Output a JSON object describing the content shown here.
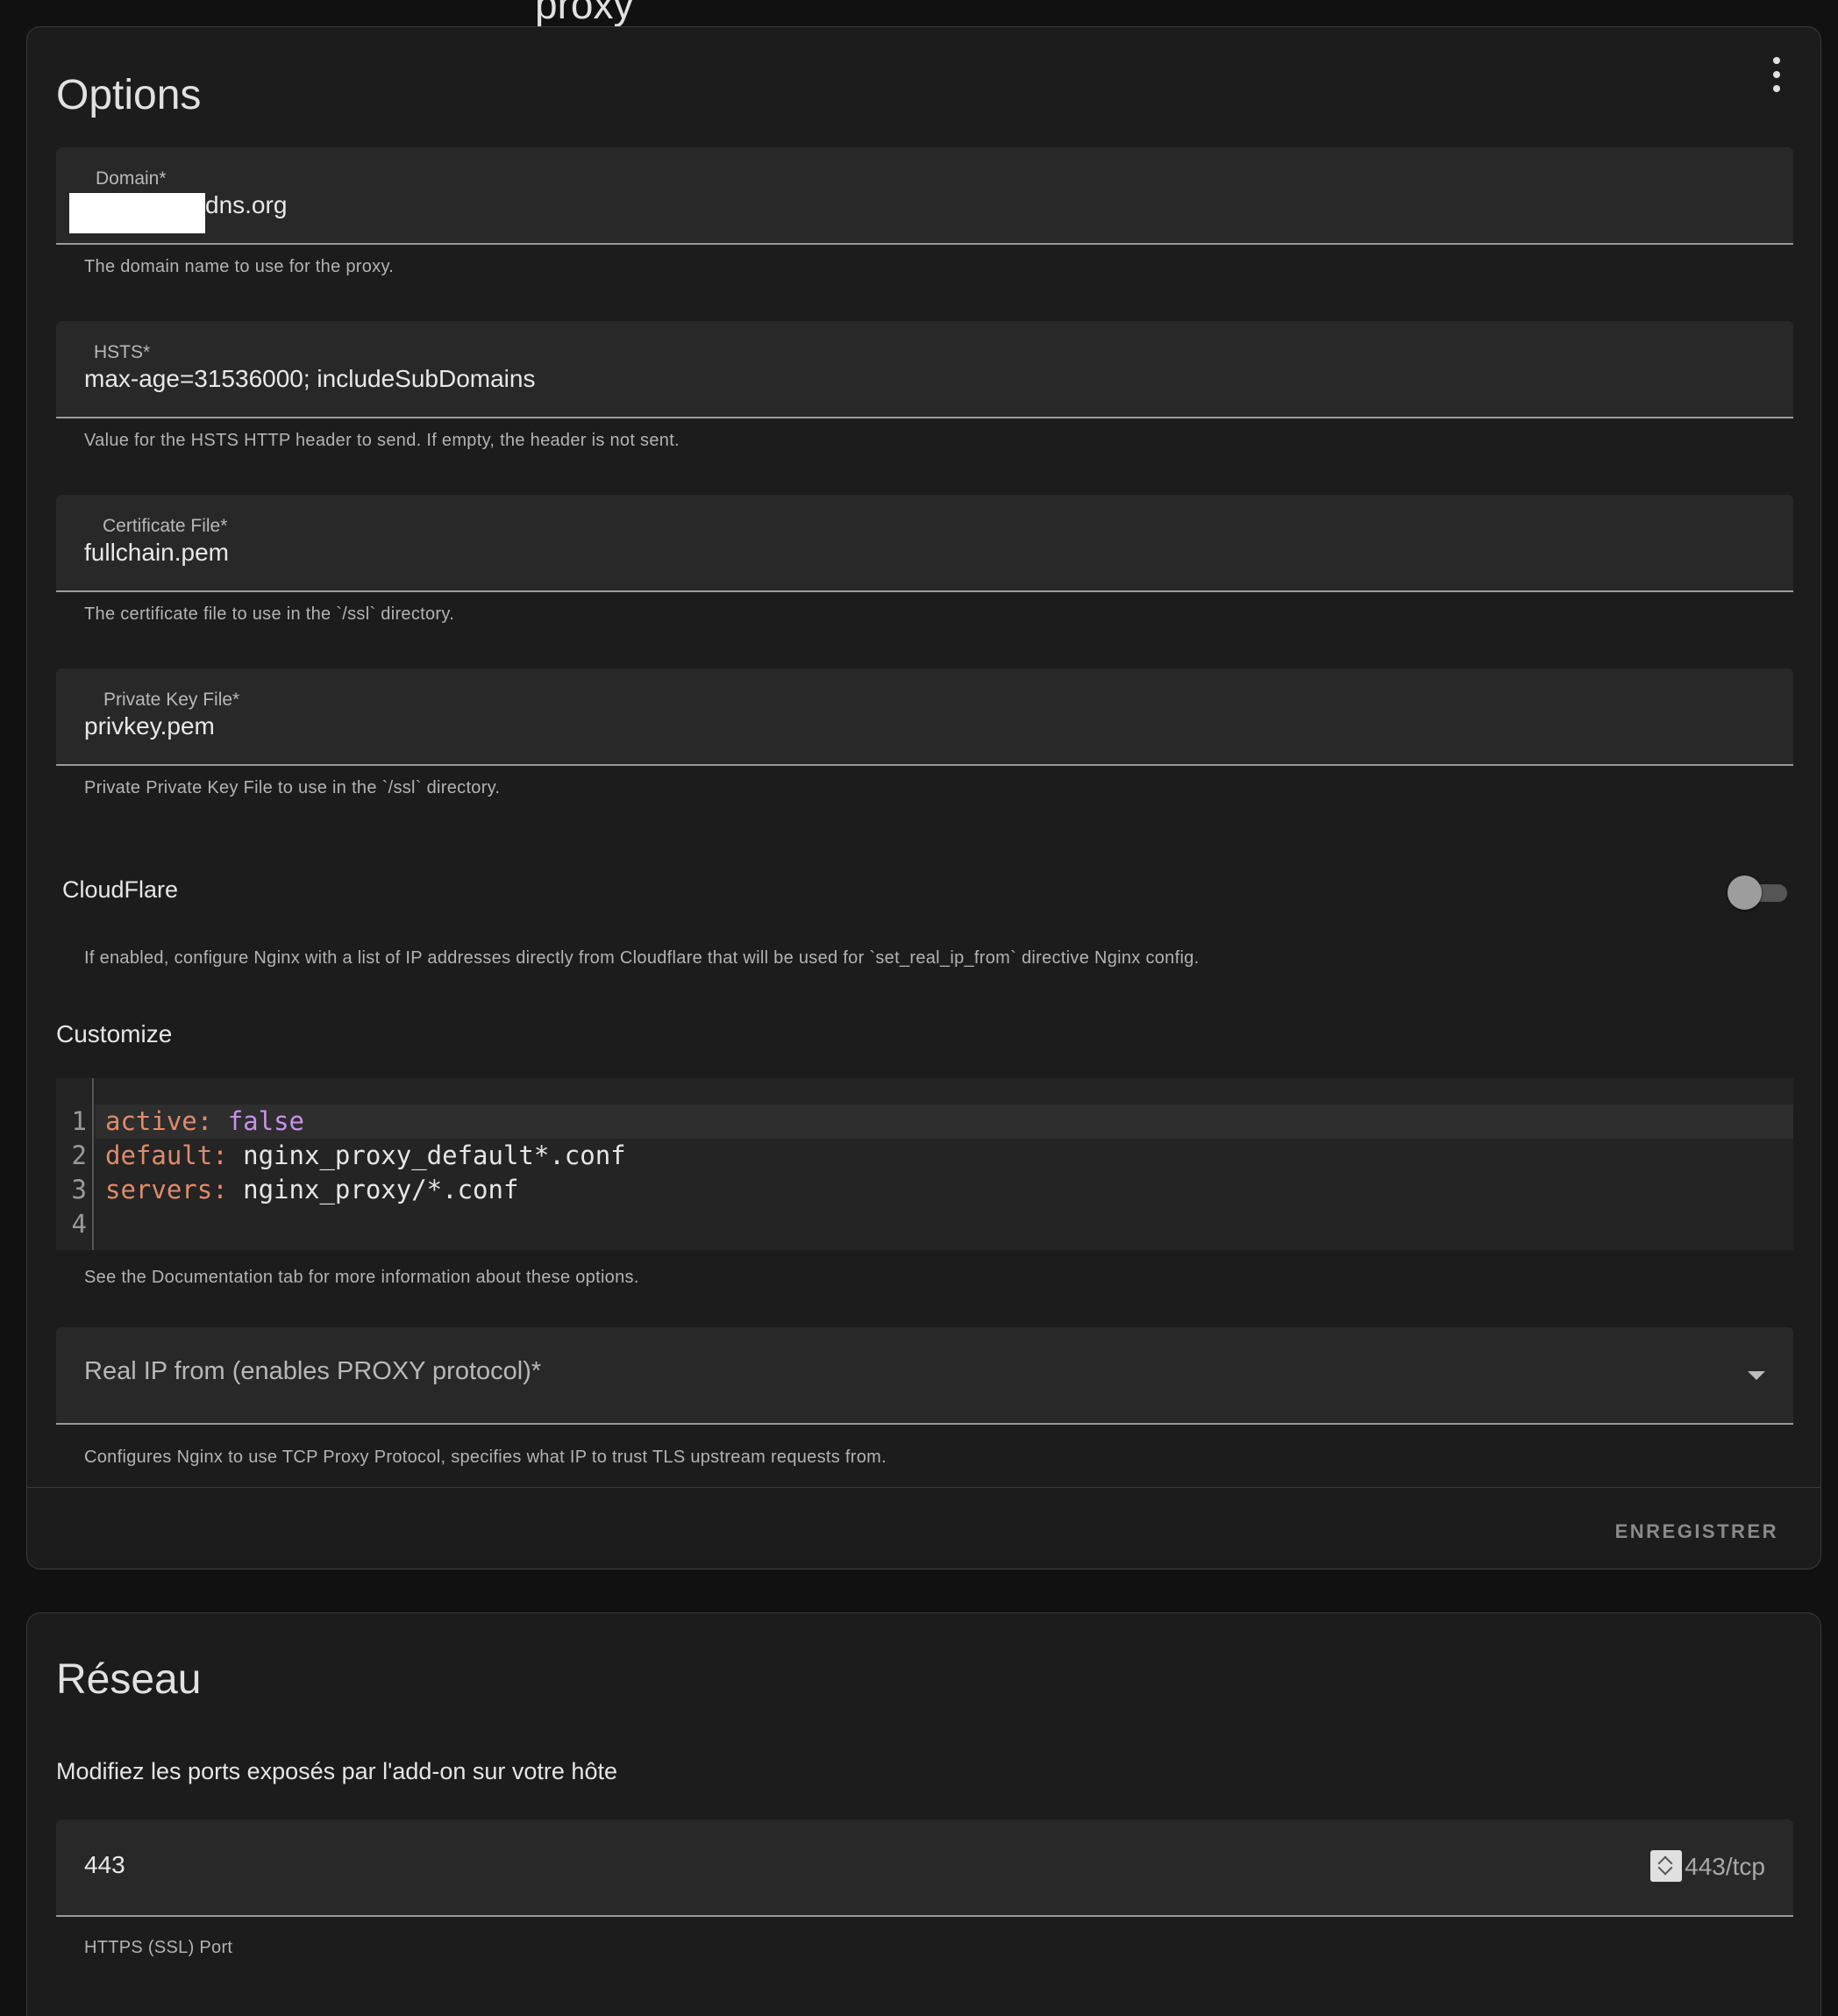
{
  "header": {
    "clipped_title": "proxy"
  },
  "options": {
    "title": "Options",
    "fields": [
      {
        "label": "Domain*",
        "value": "dns.org",
        "helper": "The domain name to use for the proxy."
      },
      {
        "label": "HSTS*",
        "value": "max-age=31536000; includeSubDomains",
        "helper": "Value for the HSTS HTTP header to send. If empty, the header is not sent."
      },
      {
        "label": "Certificate File*",
        "value": "fullchain.pem",
        "helper": "The certificate file to use in the `/ssl` directory."
      },
      {
        "label": "Private Key File*",
        "value": "privkey.pem",
        "helper": "Private Private Key File to use in the `/ssl` directory."
      }
    ],
    "cloudflare": {
      "label": "CloudFlare",
      "enabled": false,
      "helper": "If enabled, configure Nginx with a list of IP addresses directly from Cloudflare that will be used for `set_real_ip_from` directive Nginx config."
    },
    "customize": {
      "label": "Customize",
      "lines": [
        {
          "n": "1",
          "key": "active",
          "sep": ": ",
          "val": "false"
        },
        {
          "n": "2",
          "key": "default",
          "sep": ": ",
          "val": "nginx_proxy_default*.conf"
        },
        {
          "n": "3",
          "key": "servers",
          "sep": ": ",
          "val": "nginx_proxy/*.conf"
        },
        {
          "n": "4",
          "key": "",
          "sep": "",
          "val": ""
        }
      ],
      "helper": "See the Documentation tab for more information about these options."
    },
    "real_ip": {
      "label": "Real IP from (enables PROXY protocol)*",
      "helper": "Configures Nginx to use TCP Proxy Protocol, specifies what IP to trust TLS upstream requests from."
    },
    "save_label": "ENREGISTRER"
  },
  "network": {
    "title": "Réseau",
    "description": "Modifiez les ports exposés par l'add-on sur votre hôte",
    "ports": [
      {
        "value": "443",
        "suffix": "443/tcp",
        "helper": "HTTPS (SSL) Port"
      }
    ]
  },
  "colors": {
    "background": "#111111",
    "card": "#1c1c1c",
    "field": "#282828",
    "yaml_key": "#e08b6b",
    "yaml_bool": "#c792ea"
  }
}
